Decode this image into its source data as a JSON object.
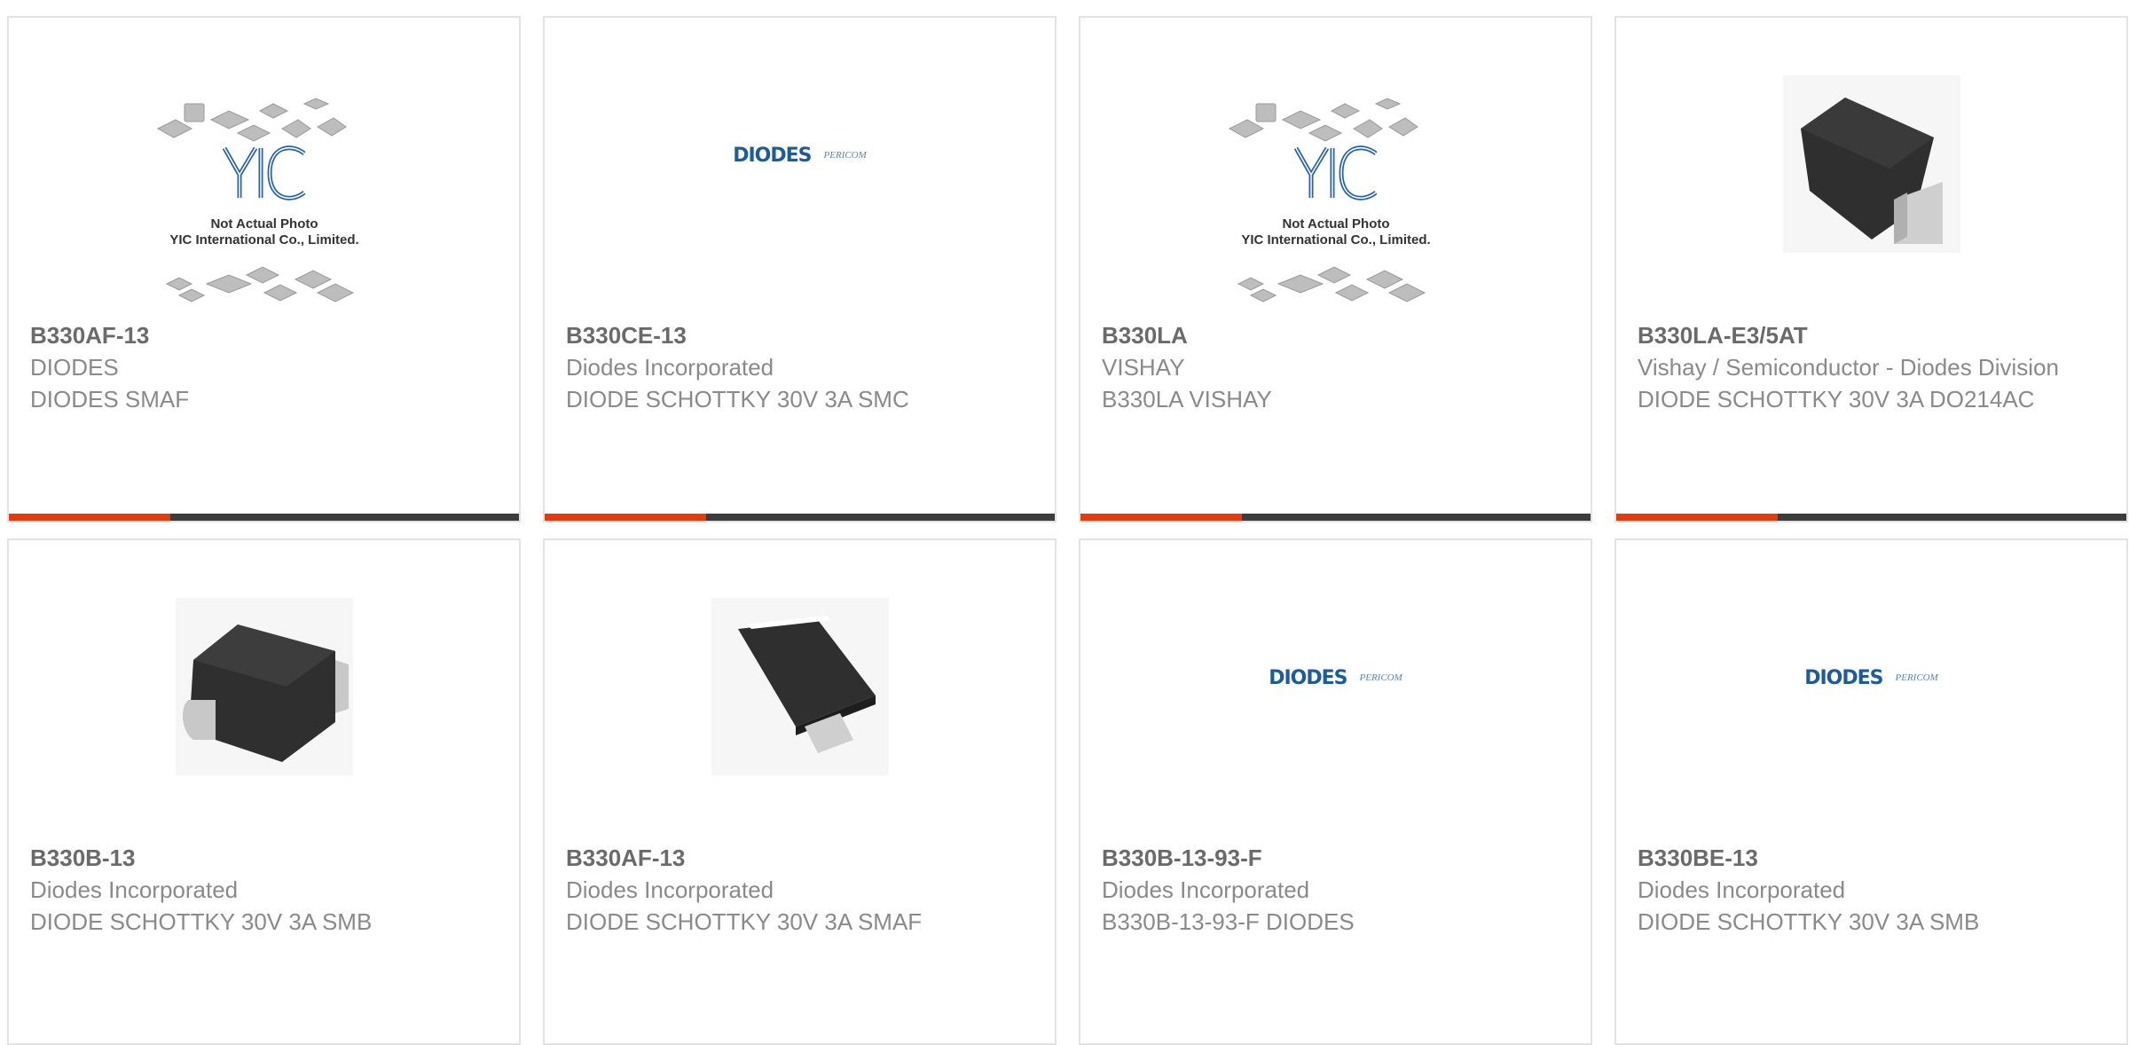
{
  "accent_color": "#e23b12",
  "bar_color": "#3c3c3c",
  "products": [
    {
      "part_number": "B330AF-13",
      "manufacturer": "DIODES",
      "description": "DIODES SMAF",
      "image": "yic-not-actual-photo",
      "image_caption_1": "Not Actual Photo",
      "image_caption_2": "YIC International Co., Limited."
    },
    {
      "part_number": "B330CE-13",
      "manufacturer": "Diodes Incorporated",
      "description": "DIODE SCHOTTKY 30V 3A SMC",
      "image": "diodes-pericom-logo",
      "logo_brand": "DIODES",
      "logo_sub": "PERICOM"
    },
    {
      "part_number": "B330LA",
      "manufacturer": "VISHAY",
      "description": "B330LA VISHAY",
      "image": "yic-not-actual-photo",
      "image_caption_1": "Not Actual Photo",
      "image_caption_2": "YIC International Co., Limited."
    },
    {
      "part_number": "B330LA-E3/5AT",
      "manufacturer": "Vishay / Semiconductor - Diodes Division",
      "description": "DIODE SCHOTTKY 30V 3A DO214AC",
      "image": "smd-package-photo"
    },
    {
      "part_number": "B330B-13",
      "manufacturer": "Diodes Incorporated",
      "description": "DIODE SCHOTTKY 30V 3A SMB",
      "image": "smb-package-photo"
    },
    {
      "part_number": "B330AF-13",
      "manufacturer": "Diodes Incorporated",
      "description": "DIODE SCHOTTKY 30V 3A SMAF",
      "image": "smaf-package-photo"
    },
    {
      "part_number": "B330B-13-93-F",
      "manufacturer": "Diodes Incorporated",
      "description": "B330B-13-93-F DIODES",
      "image": "diodes-pericom-logo",
      "logo_brand": "DIODES",
      "logo_sub": "PERICOM"
    },
    {
      "part_number": "B330BE-13",
      "manufacturer": "Diodes Incorporated",
      "description": "DIODE SCHOTTKY 30V 3A SMB",
      "image": "diodes-pericom-logo",
      "logo_brand": "DIODES",
      "logo_sub": "PERICOM"
    }
  ]
}
